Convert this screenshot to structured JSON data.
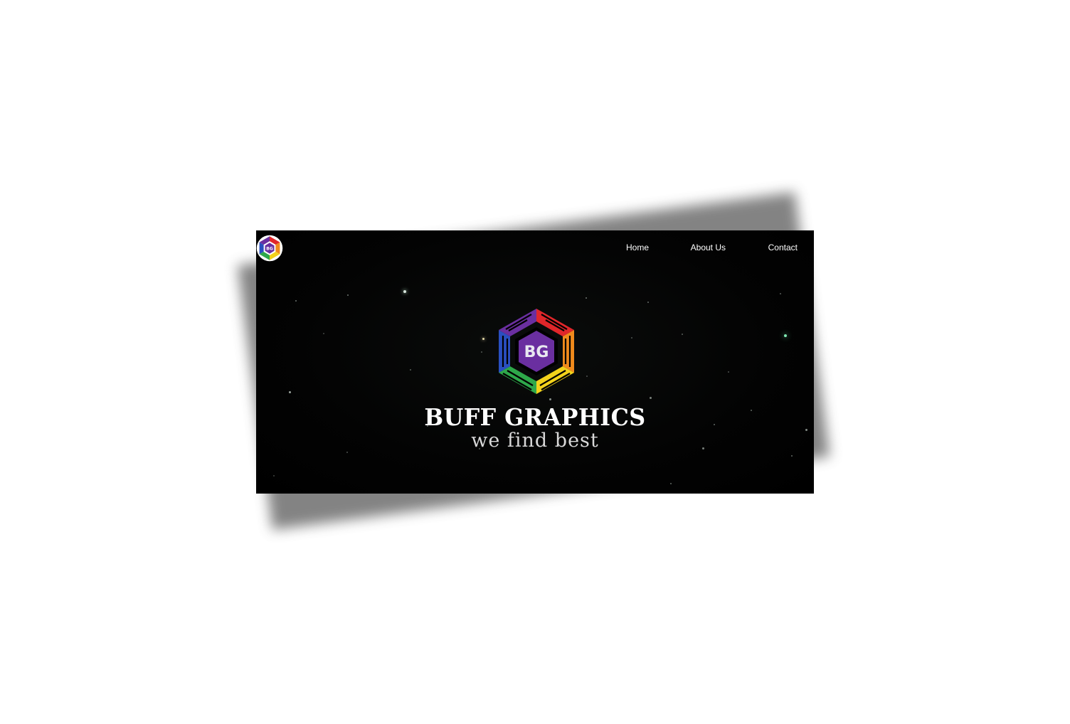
{
  "header": {
    "logo_icon": "bg-hexagon-logo-icon",
    "nav": [
      {
        "label": "Home"
      },
      {
        "label": "About Us"
      },
      {
        "label": "Contact"
      }
    ]
  },
  "hero": {
    "logo_icon": "bg-hexagon-logo-icon",
    "logo_monogram": "BG",
    "title": "BUFF GRAPHICS",
    "tagline": "we find best"
  },
  "colors": {
    "background": "#000000",
    "page_background": "#ffffff",
    "shadow": "#6e6e6e",
    "text": "#ffffff",
    "logo_purple": "#6a2fa0",
    "logo_red": "#e0262a",
    "logo_orange": "#f08a1c",
    "logo_yellow": "#f2d21b",
    "logo_green": "#2ea84a",
    "logo_blue": "#2a4fc0"
  }
}
